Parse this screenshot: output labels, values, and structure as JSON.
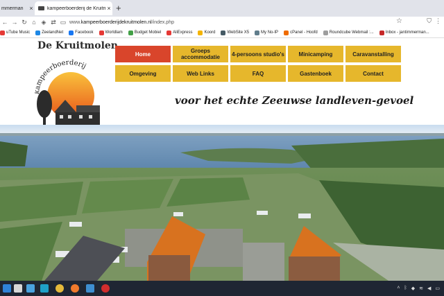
{
  "browser": {
    "tabs": [
      {
        "label": "mmerman"
      },
      {
        "label": "kampeerboerderij de Kruitmolen"
      }
    ],
    "new_tab": "+",
    "url": {
      "prefix": "www.",
      "domain": "kampeerboerderijdekruitmolen.nl",
      "path": "/index.php"
    },
    "bookmarks": [
      {
        "label": "uTube Music",
        "color": "#e53935"
      },
      {
        "label": "ZeelandNet",
        "color": "#1e88e5"
      },
      {
        "label": "Facebook",
        "color": "#1877f2"
      },
      {
        "label": "Worldlam",
        "color": "#e53935"
      },
      {
        "label": "Budget Mobiel",
        "color": "#43a047"
      },
      {
        "label": "AliExpress",
        "color": "#e53935"
      },
      {
        "label": "Koord",
        "color": "#f4b400"
      },
      {
        "label": "WebSite X5",
        "color": "#455a64"
      },
      {
        "label": "My No-IP",
        "color": "#607d8b"
      },
      {
        "label": "cPanel - Hoofd",
        "color": "#ef6c00"
      },
      {
        "label": "Roundcube Webmail :...",
        "color": "#9e9e9e"
      },
      {
        "label": "Inbox - jantimmerman...",
        "color": "#c62828"
      }
    ]
  },
  "site": {
    "logo_title": "De Kruitmolen",
    "logo_arc_text": "kampeerboerderij",
    "nav": [
      {
        "label": "Home",
        "active": true
      },
      {
        "label": "Groeps accommodatie",
        "active": false
      },
      {
        "label": "4-persoons studio's",
        "active": false
      },
      {
        "label": "Minicamping",
        "active": false
      },
      {
        "label": "Caravanstalling",
        "active": false
      },
      {
        "label": "Omgeving",
        "active": false
      },
      {
        "label": "Web Links",
        "active": false
      },
      {
        "label": "FAQ",
        "active": false
      },
      {
        "label": "Gastenboek",
        "active": false
      },
      {
        "label": "Contact",
        "active": false
      }
    ],
    "tagline": "voor het echte Zeeuwse landleven-gevoel"
  },
  "colors": {
    "nav_button": "#e6b72c",
    "nav_active": "#d9452b",
    "taskbar": "#1f2633"
  },
  "taskbar": {
    "icons": [
      "windows-start",
      "search",
      "file-explorer",
      "edge",
      "chrome",
      "firefox",
      "notepad",
      "pinned-app"
    ]
  }
}
